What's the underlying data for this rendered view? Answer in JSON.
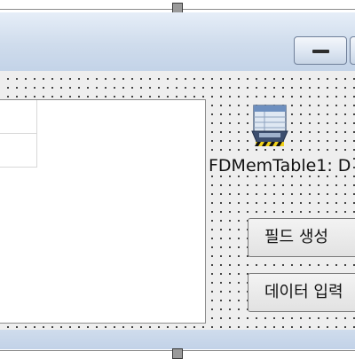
{
  "window": {
    "minimize_icon": "minimize-icon"
  },
  "components": {
    "memtable": {
      "label": "FDMemTable1: D",
      "icon": "fdmemtable-icon"
    }
  },
  "buttons": {
    "create_fields": "필드 생성",
    "data_input": "데이터 입력"
  },
  "colors": {
    "title_bar": "#cfdcec",
    "client_bg": "#eeeeee",
    "grid_bg": "#ffffff"
  }
}
